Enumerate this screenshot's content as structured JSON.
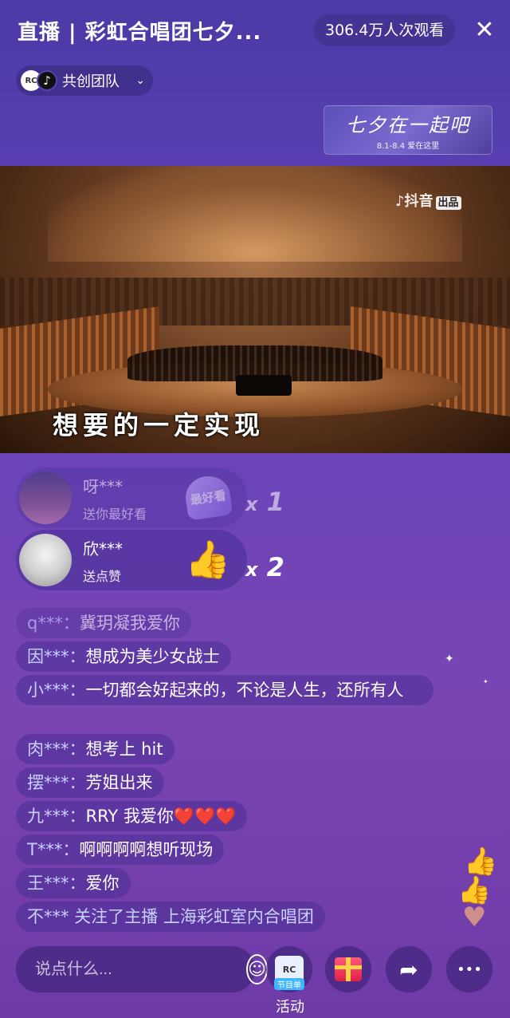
{
  "header": {
    "title": "直播 | 彩虹合唱团七夕...",
    "viewers": "306.4万人次观看",
    "close_glyph": "✕",
    "team_label": "共创团队",
    "team_chevron": "⌄",
    "banner_title": "七夕在一起吧",
    "banner_sub": "8.1-8.4  爱在这里"
  },
  "video": {
    "watermark": "抖音",
    "watermark_tag": "出品",
    "subtitle": "想要的一定实现"
  },
  "gifts": [
    {
      "user": "呀***",
      "desc": "送你最好看",
      "gift_text": "最好看",
      "count_x": "x",
      "count": "1"
    },
    {
      "user": "欣***",
      "desc": "送点赞",
      "gift_text": "👍",
      "count_x": "x",
      "count": "2"
    }
  ],
  "chat": [
    {
      "user": "q***：",
      "text": "冀玥凝我爱你"
    },
    {
      "user": "因***：",
      "text": "想成为美少女战士"
    },
    {
      "user": "小***：",
      "text": "一切都会好起来的，不论是人生，还所有人"
    },
    {
      "user": "肉***：",
      "text": "想考上 hit"
    },
    {
      "user": "摆***：",
      "text": "芳姐出来"
    },
    {
      "user": "九***：",
      "text": "RRY 我爱你❤️❤️❤️"
    },
    {
      "user": "T***：",
      "text": "啊啊啊啊想听现场"
    },
    {
      "user": "王***：",
      "text": "爱你"
    },
    {
      "user": "不***",
      "text": " 关注了主播 上海彩虹室内合唱团"
    }
  ],
  "bottom": {
    "input_placeholder": "说点什么...",
    "activity_tag": "节目单",
    "activity_label": "活动",
    "share_glyph": "➦",
    "more_glyph": "•••"
  },
  "colors": {
    "background_top": "#4b3aa6",
    "background_bottom": "#6e3aa6",
    "chat_username": "#c8d2ff"
  }
}
